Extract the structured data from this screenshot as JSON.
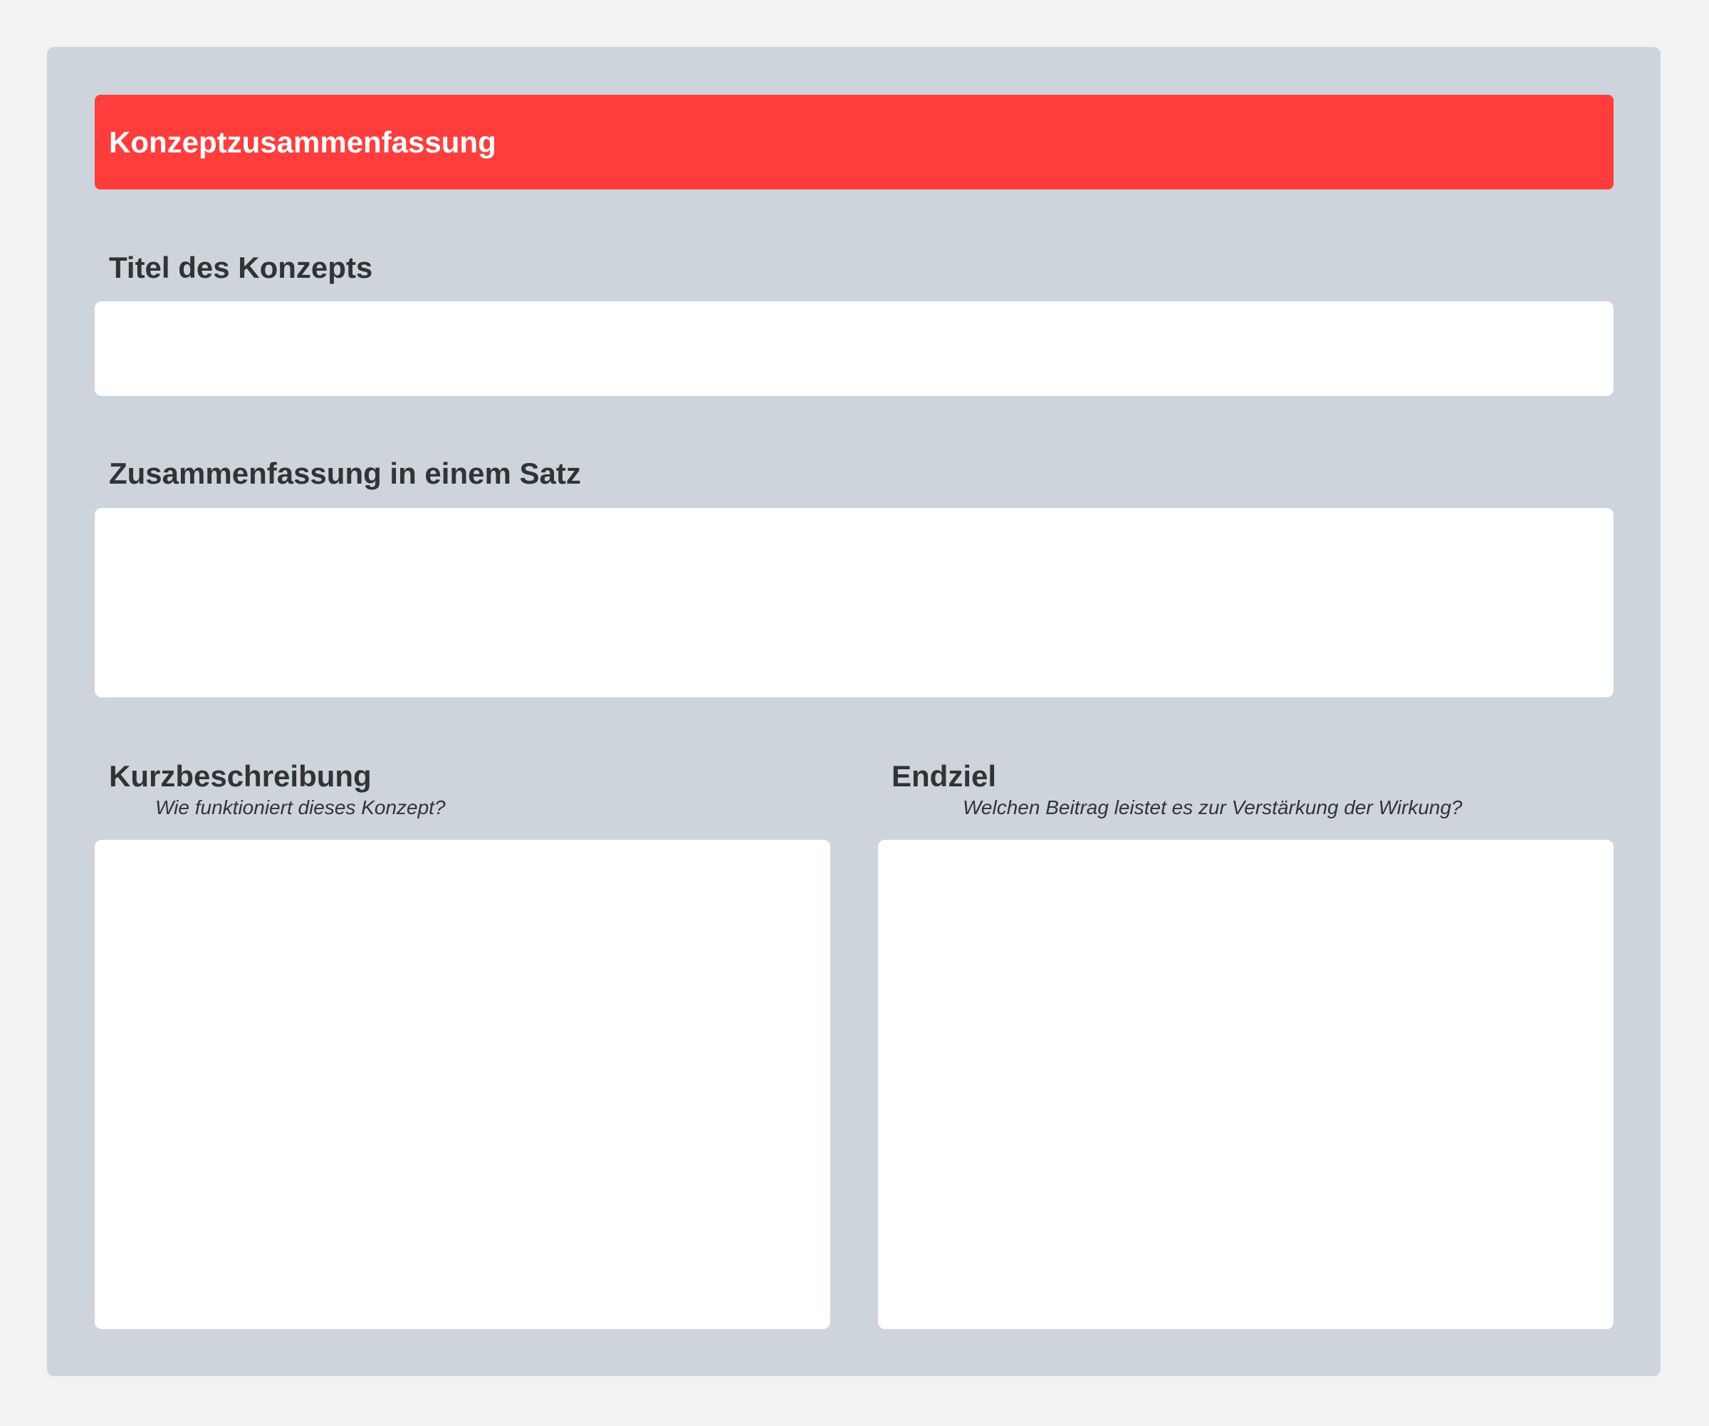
{
  "header": {
    "title": "Konzeptzusammenfassung",
    "color": "#ff3d3d"
  },
  "sections": {
    "title": {
      "label": "Titel des Konzepts",
      "value": ""
    },
    "summary": {
      "label": "Zusammenfassung in einem Satz",
      "value": ""
    },
    "description": {
      "label": "Kurzbeschreibung",
      "subtitle": "Wie funktioniert dieses Konzept?",
      "value": ""
    },
    "goal": {
      "label": "Endziel",
      "subtitle": "Welchen Beitrag leistet es zur Verstärkung der Wirkung?",
      "value": ""
    }
  },
  "colors": {
    "page_background": "#f0f2f4",
    "board_background": "#cdd4dc",
    "field_background": "#ffffff",
    "text": "#333333"
  }
}
